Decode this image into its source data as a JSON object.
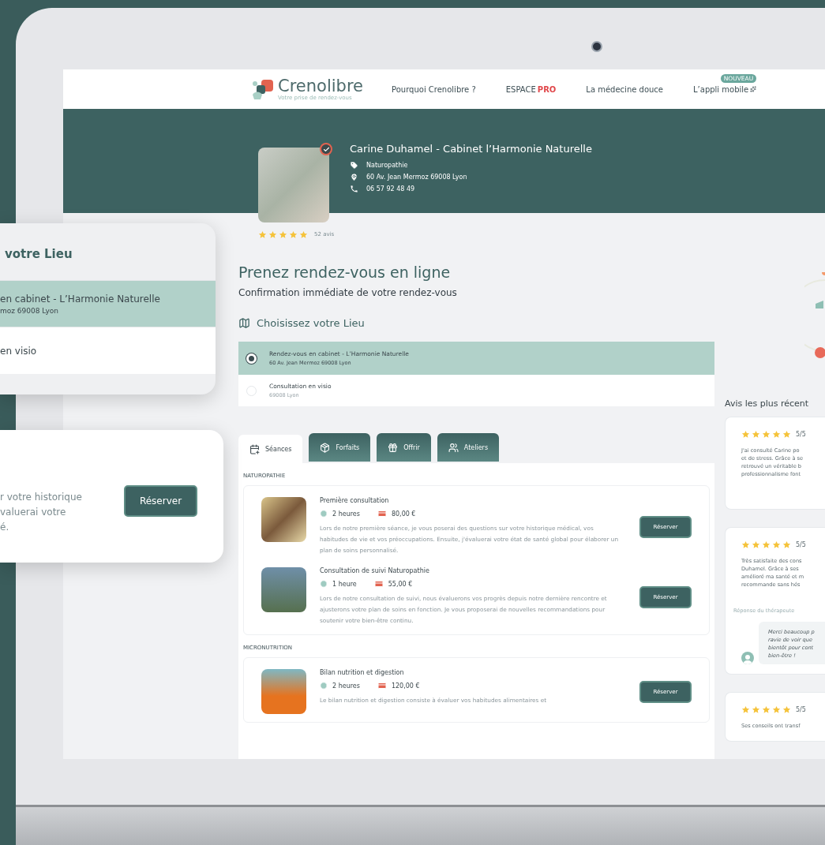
{
  "header": {
    "logo": {
      "name": "Crenolibre",
      "tagline": "Votre prise de rendez-vous"
    },
    "nav": [
      {
        "label": "Pourquoi Crenolibre ?"
      },
      {
        "label": "ESPACE",
        "highlight": "PRO"
      },
      {
        "label": "La médecine douce"
      },
      {
        "label": "L’appli mobile",
        "badge": "NOUVEAU"
      }
    ]
  },
  "practitioner": {
    "name": "Carine Duhamel - Cabinet l’Harmonie Naturelle",
    "verified": true,
    "details": [
      {
        "kind": "tag",
        "text": "Naturopathie"
      },
      {
        "kind": "location",
        "text": "60 Av. Jean Mermoz 69008 Lyon"
      },
      {
        "kind": "phone",
        "text": "06 57 92 48 49"
      }
    ],
    "stars": 5,
    "reviews_count": "52 avis"
  },
  "booking": {
    "title": "Prenez rendez-vous en ligne",
    "subtitle": "Confirmation immédiate de votre rendez-vous",
    "location_heading": "Choisissez votre Lieu",
    "locations": [
      {
        "name": "Rendez-vous en cabinet - L’Harmonie Naturelle",
        "address": "60 Av. Jean Mermoz 69008 Lyon",
        "selected": true
      },
      {
        "name": "Consultation en visio",
        "address": "69008 Lyon",
        "selected": false
      }
    ],
    "tabs": [
      {
        "label": "Séances",
        "kind": "calendar",
        "selected": true
      },
      {
        "label": "Forfaits",
        "kind": "box",
        "selected": false
      },
      {
        "label": "Offrir",
        "kind": "gift",
        "selected": false
      },
      {
        "label": "Ateliers",
        "kind": "people",
        "selected": false
      }
    ],
    "sections": [
      {
        "title": "NATUROPATHIE",
        "services": [
          {
            "title": "Première consultation",
            "duration": "2 heures",
            "price": "80,00 €",
            "description": "Lors de notre première séance, je vous poserai des questions sur votre historique médical, vos habitudes de vie et vos préoccupations. Ensuite, j'évaluerai votre état de santé global pour élaborer un plan de soins personnalisé.",
            "button": "Réserver"
          },
          {
            "title": "Consultation de suivi Naturopathie",
            "duration": "1 heure",
            "price": "55,00 €",
            "description": "Lors de notre consultation de suivi, nous évaluerons vos progrès depuis notre dernière rencontre et ajusterons votre plan de soins en fonction. Je vous proposerai de nouvelles recommandations pour soutenir votre bien-être continu.",
            "button": "Réserver"
          }
        ]
      },
      {
        "title": "MICRONUTRITION",
        "services": [
          {
            "title": "Bilan nutrition et digestion",
            "duration": "2 heures",
            "price": "120,00 €",
            "description": "Le bilan nutrition et digestion consiste à évaluer vos habitudes alimentaires et",
            "button": "Réserver"
          }
        ]
      }
    ]
  },
  "reviews": {
    "title": "Avis les plus récent",
    "items": [
      {
        "stars": 5,
        "score": "5/5",
        "lines": [
          "J'ai consulté Carine po",
          "et de stress. Grâce à se",
          "retrouvé un véritable b",
          "professionnalisme font"
        ]
      },
      {
        "stars": 5,
        "score": "5/5",
        "lines": [
          "Très satisfaite des cons",
          "Duhamel. Grâce à ses",
          "amélioré ma santé et m",
          "recommande sans hés"
        ],
        "reply": {
          "label": "Réponse du thérapeute",
          "lines": [
            "Merci beaucoup p",
            "ravie de voir que",
            "bientôt pour cont",
            "bien-être !"
          ]
        }
      },
      {
        "stars": 5,
        "score": "5/5",
        "lines": [
          "Ses conseils ont transf"
        ]
      }
    ]
  },
  "overlay_cards": [
    {
      "kind": "location",
      "heading": "votre Lieu",
      "options": [
        {
          "name": "en cabinet - L’Harmonie Naturelle",
          "address": "moz 69008 Lyon",
          "selected": true
        },
        {
          "name": "en visio",
          "selected": false
        }
      ]
    },
    {
      "kind": "service",
      "lines": [
        "r votre historique",
        "valuerai votre",
        "é."
      ],
      "button": "Réserver"
    }
  ]
}
